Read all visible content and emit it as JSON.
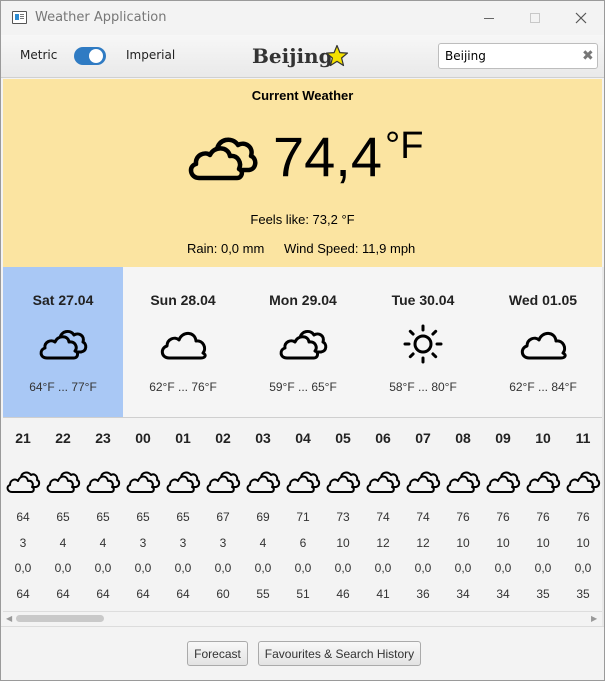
{
  "window": {
    "title": "Weather Application"
  },
  "toolbar": {
    "metric_label": "Metric",
    "imperial_label": "Imperial",
    "toggle_state": "imperial",
    "city": "Beijing",
    "favourite_icon": "star-icon",
    "search_value": "Beijing",
    "clear_glyph": "✖"
  },
  "current": {
    "heading": "Current Weather",
    "icon": "cloud-icon",
    "temperature": "74,4",
    "unit": "°F",
    "feels_like": "Feels like: 73,2 °F",
    "rain": "Rain: 0,0 mm",
    "wind": "Wind Speed: 11,9 mph",
    "background": "#fbe4a1"
  },
  "daily": [
    {
      "name": "Sat 27.04",
      "icon": "clouds-icon",
      "range": "64°F ... 77°F",
      "selected": true
    },
    {
      "name": "Sun 28.04",
      "icon": "cloud-icon",
      "range": "62°F ... 76°F",
      "selected": false
    },
    {
      "name": "Mon 29.04",
      "icon": "clouds-icon",
      "range": "59°F ... 65°F",
      "selected": false
    },
    {
      "name": "Tue 30.04",
      "icon": "sun-icon",
      "range": "58°F ... 80°F",
      "selected": false
    },
    {
      "name": "Wed 01.05",
      "icon": "cloud-icon",
      "range": "62°F ... 84°F",
      "selected": false
    }
  ],
  "hourly": [
    {
      "hour": "21",
      "icon": "cloud-icon",
      "temp": "64",
      "wind": "3",
      "rain": "0,0",
      "humidity": "64"
    },
    {
      "hour": "22",
      "icon": "cloud-icon",
      "temp": "65",
      "wind": "4",
      "rain": "0,0",
      "humidity": "64"
    },
    {
      "hour": "23",
      "icon": "cloud-icon",
      "temp": "65",
      "wind": "4",
      "rain": "0,0",
      "humidity": "64"
    },
    {
      "hour": "00",
      "icon": "cloud-icon",
      "temp": "65",
      "wind": "3",
      "rain": "0,0",
      "humidity": "64"
    },
    {
      "hour": "01",
      "icon": "cloud-icon",
      "temp": "65",
      "wind": "3",
      "rain": "0,0",
      "humidity": "64"
    },
    {
      "hour": "02",
      "icon": "cloud-icon",
      "temp": "67",
      "wind": "3",
      "rain": "0,0",
      "humidity": "60"
    },
    {
      "hour": "03",
      "icon": "cloud-icon",
      "temp": "69",
      "wind": "4",
      "rain": "0,0",
      "humidity": "55"
    },
    {
      "hour": "04",
      "icon": "cloud-icon",
      "temp": "71",
      "wind": "6",
      "rain": "0,0",
      "humidity": "51"
    },
    {
      "hour": "05",
      "icon": "cloud-icon",
      "temp": "73",
      "wind": "10",
      "rain": "0,0",
      "humidity": "46"
    },
    {
      "hour": "06",
      "icon": "cloud-icon",
      "temp": "74",
      "wind": "12",
      "rain": "0,0",
      "humidity": "41"
    },
    {
      "hour": "07",
      "icon": "cloud-icon",
      "temp": "74",
      "wind": "12",
      "rain": "0,0",
      "humidity": "36"
    },
    {
      "hour": "08",
      "icon": "cloud-icon",
      "temp": "76",
      "wind": "10",
      "rain": "0,0",
      "humidity": "34"
    },
    {
      "hour": "09",
      "icon": "cloud-icon",
      "temp": "76",
      "wind": "10",
      "rain": "0,0",
      "humidity": "34"
    },
    {
      "hour": "10",
      "icon": "cloud-icon",
      "temp": "76",
      "wind": "10",
      "rain": "0,0",
      "humidity": "35"
    },
    {
      "hour": "11",
      "icon": "cloud-icon",
      "temp": "76",
      "wind": "10",
      "rain": "0,0",
      "humidity": "35"
    }
  ],
  "buttons": {
    "forecast": "Forecast",
    "favourites": "Favourites & Search History"
  },
  "colors": {
    "accent": "#2f7bc3",
    "selected_day": "#a9c8f5",
    "star": "#f4e000"
  }
}
